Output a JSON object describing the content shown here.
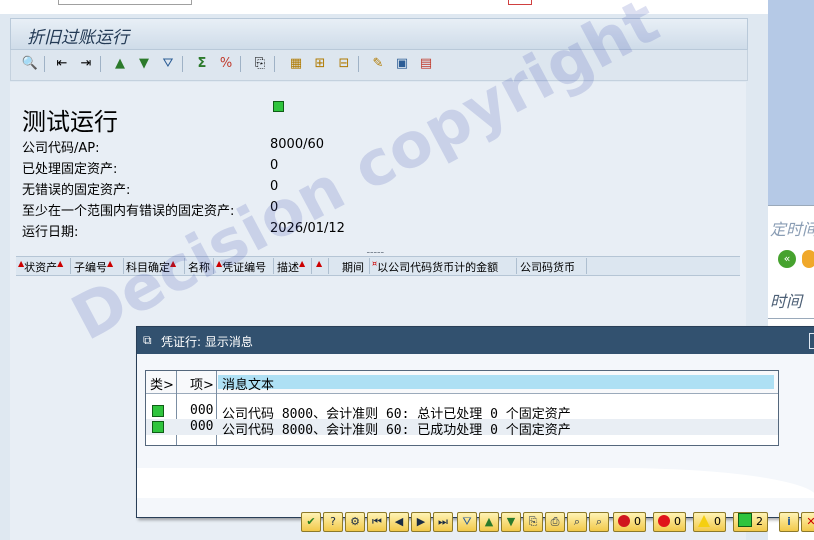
{
  "app_title": "折旧过账运行",
  "toolbar": {
    "icons": [
      "find-icon",
      "first-page-icon",
      "last-page-icon",
      "sort-ascending-icon",
      "sort-descending-icon",
      "filter-icon",
      "sum-icon",
      "subtotal-icon",
      "export-icon",
      "layout-icon",
      "change-layout-icon",
      "select-layout-icon",
      "graphic-icon",
      "spreadsheet-icon",
      "abc-analysis-icon"
    ]
  },
  "report": {
    "heading": "测试运行",
    "fields": [
      {
        "label": "公司代码/AP:",
        "value": "8000/60"
      },
      {
        "label": "已处理固定资产:",
        "value": "0"
      },
      {
        "label": "无错误的固定资产:",
        "value": "0"
      },
      {
        "label": "至少在一个范围内有错误的固定资产:",
        "value": "0"
      },
      {
        "label": "运行日期:",
        "value": "2026/01/12"
      }
    ],
    "columns": [
      "状资产",
      "子编号",
      "科目确定",
      "名称",
      "凭证编号",
      "描述",
      "",
      "期间",
      "以公司代码货币计的金额",
      "公司码货币"
    ],
    "sash": "⁃⁃⁃⁃⁃"
  },
  "background_window": {
    "label1": "定时间",
    "label2": "时间"
  },
  "dialog": {
    "title": "凭证行: 显示消息",
    "grid_headers": {
      "type": "类",
      "item": "项",
      "text": "消息文本"
    },
    "rows": [
      {
        "item": "000",
        "text": "公司代码 8000、会计准则 60: 总计已处理 0 个固定资产"
      },
      {
        "item": "000",
        "text": "公司代码 8000、会计准则 60: 已成功处理 0 个固定资产"
      }
    ],
    "counters": {
      "stop": "0",
      "error": "0",
      "warning": "0",
      "success": "2"
    }
  },
  "watermark": "Decision copyright",
  "colors": {
    "title_bar": "#32516f",
    "accent_green": "#2fc43d",
    "toolbar_gold": "#f2c94a"
  }
}
